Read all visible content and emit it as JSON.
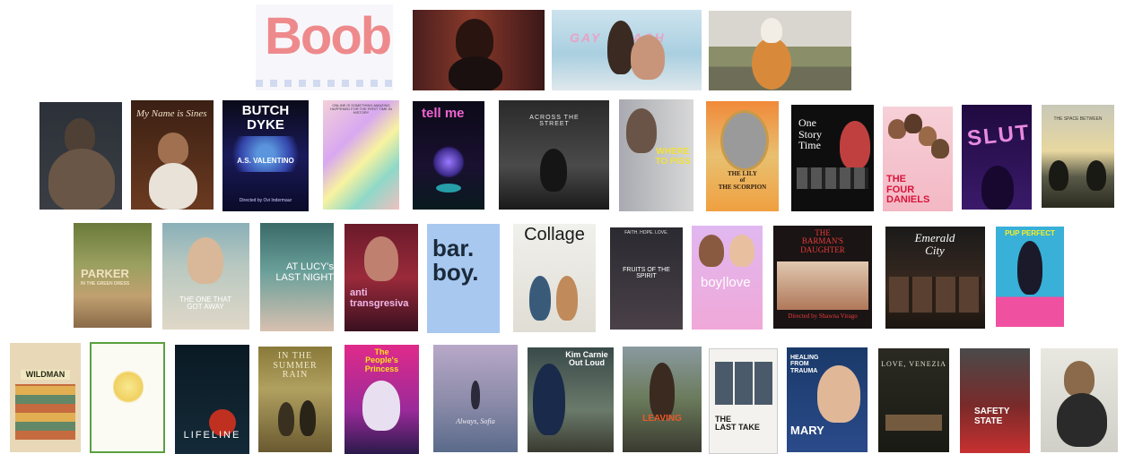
{
  "posters": {
    "boob": {
      "title": "Boob"
    },
    "gay_beach": {
      "title": "GAY  BEACH"
    },
    "butch_dyke": {
      "title": "BUTCH\nDYKE",
      "name": "A.S. VALENTINO",
      "credit": "Directed by Ovi Indermaur"
    },
    "my_name": {
      "title": "My Name is Sines"
    },
    "every_body": {
      "tagline": "ONLINE IS SOMETHING AMAZING\nHAPPENED FOR THE FIRST TIME IN HISTORY"
    },
    "tell_me": {
      "title": "tell me"
    },
    "across": {
      "title": "ACROSS THE\nSTREET"
    },
    "where_to_piss": {
      "title": "WHERE\nTO PISS"
    },
    "scorpion": {
      "title": "THE LILY\nof\nTHE SCORPION"
    },
    "one_story": {
      "title": "One\nStory\nTime"
    },
    "four_daniels": {
      "title": "THE\nFOUR\nDANIELS"
    },
    "slut": {
      "title": "SLUT"
    },
    "space_between": {
      "title": "THE SPACE BETWEEN"
    },
    "parker": {
      "title": "PARKER",
      "subtitle": "IN THE GREEN DRESS"
    },
    "one_got_away": {
      "title": "THE ONE THAT\nGOT AWAY"
    },
    "at_lucys": {
      "title": "AT LUCY's\nLAST NIGHT"
    },
    "anti": {
      "title": "anti\ntransgresiva"
    },
    "bar_boy": {
      "title": "bar.\nboy."
    },
    "collage": {
      "title": "Collage"
    },
    "fruits": {
      "tagline": "FAITH. HOPE. LOVE.",
      "title": "FRUITS OF THE SPIRIT"
    },
    "boylove": {
      "title": "boy|love"
    },
    "barman": {
      "title": "THE\nBARMAN'S\nDAUGHTER",
      "credit": "Directed by Shawna Virago"
    },
    "emerald": {
      "title": "Emerald\nCity"
    },
    "pup": {
      "title": "PUP PERFECT"
    },
    "wildman": {
      "title": "WILDMAN"
    },
    "lifeline": {
      "title": "LIFELINE"
    },
    "summer_rain": {
      "title": "IN THE\nSUMMER\nRAIN"
    },
    "peoples": {
      "title": "The\nPeople's\nPrincess"
    },
    "sofia": {
      "title": "Always, Sofia"
    },
    "kim": {
      "title": "Kim Carnie\nOut Loud"
    },
    "leaving": {
      "title": "LEAVING"
    },
    "last_take": {
      "title": "THE\nLAST TAKE"
    },
    "mary": {
      "tagline": "HEALING FROM\nTRAUMA",
      "title": "MARY"
    },
    "venezia": {
      "title": "LOVE, VENEZIA"
    },
    "safety": {
      "title": "SAFETY\nSTATE"
    }
  }
}
